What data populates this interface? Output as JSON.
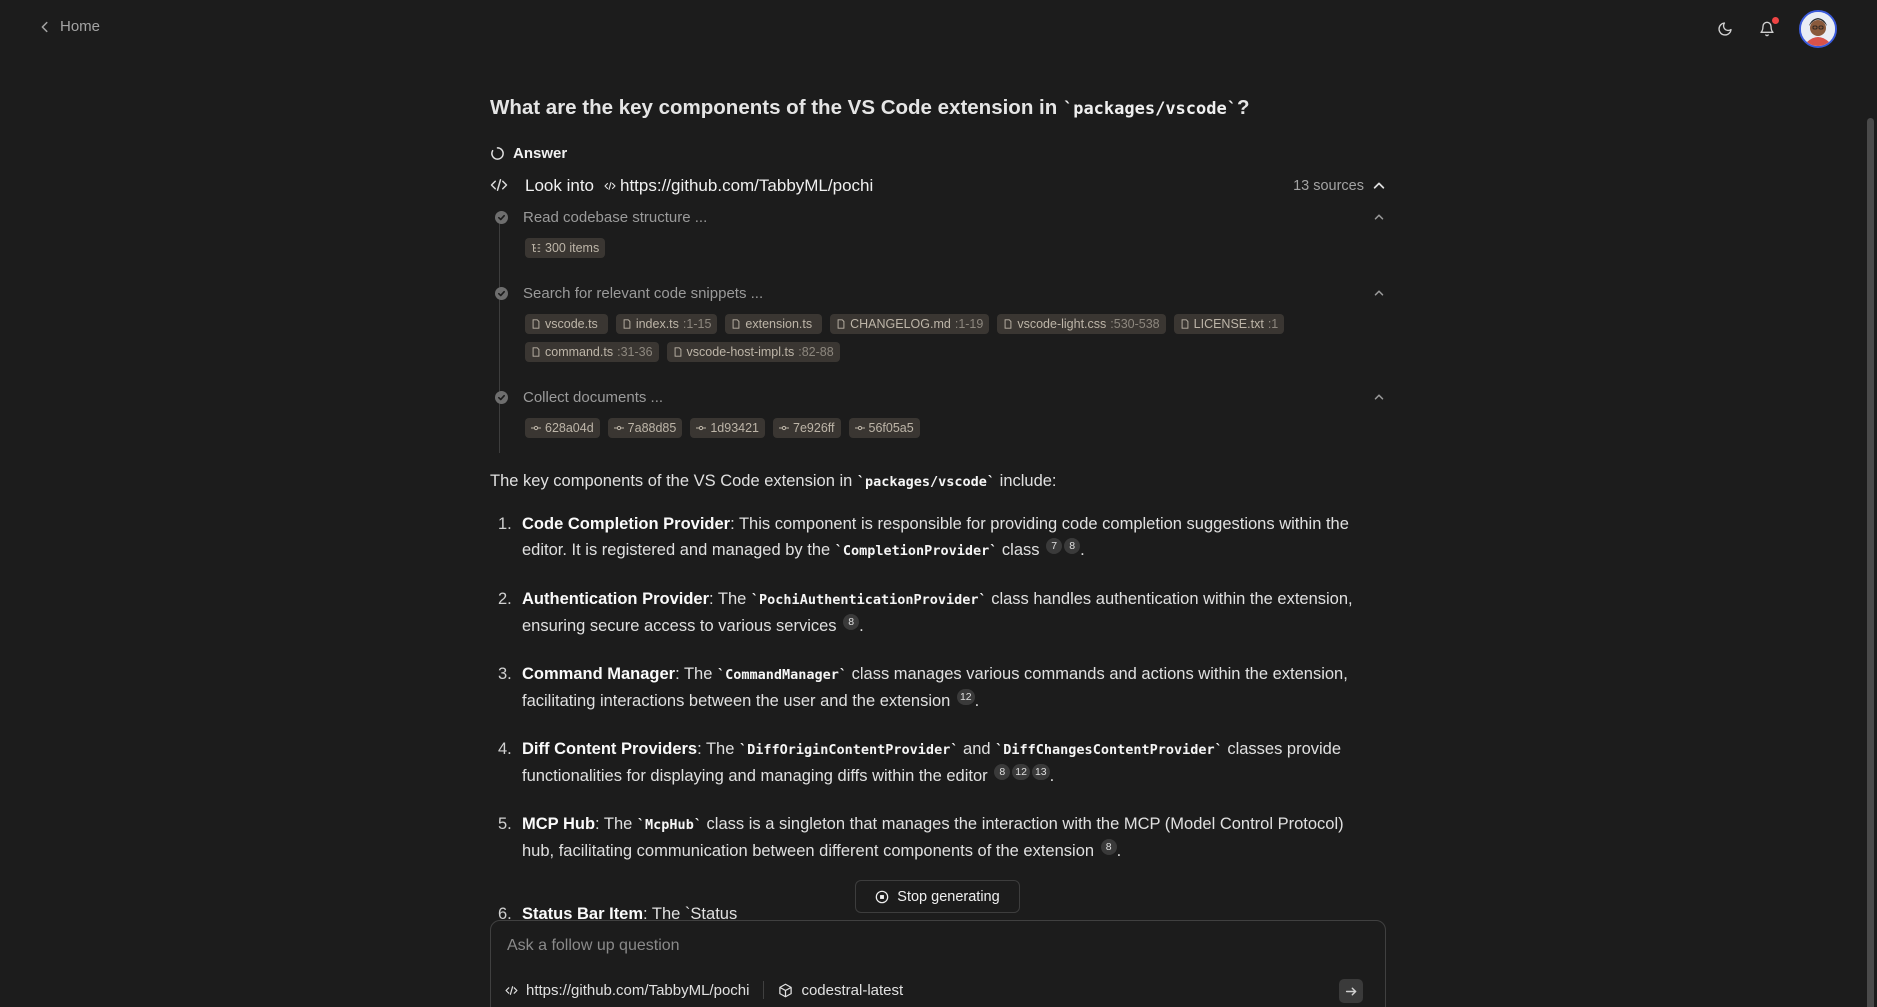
{
  "header": {
    "home_label": "Home",
    "icons": [
      "moon-icon",
      "bell-icon",
      "user-avatar"
    ]
  },
  "question": {
    "prefix": "What are the key components of the VS Code extension in ",
    "code": "`packages/vscode`",
    "suffix": "?"
  },
  "answer": {
    "label": "Answer",
    "look_into_label": "Look into",
    "repo_url": "https://github.com/TabbyML/pochi",
    "sources_label": "13 sources"
  },
  "steps": [
    {
      "title": "Read codebase structure ...",
      "chips": [
        {
          "name": "300 items",
          "range": ""
        }
      ]
    },
    {
      "title": "Search for relevant code snippets ...",
      "chips": [
        {
          "name": "vscode.ts",
          "range": ""
        },
        {
          "name": "index.ts",
          "range": ":1-15"
        },
        {
          "name": "extension.ts",
          "range": ""
        },
        {
          "name": "CHANGELOG.md",
          "range": ":1-19"
        },
        {
          "name": "vscode-light.css",
          "range": ":530-538"
        },
        {
          "name": "LICENSE.txt",
          "range": ":1"
        },
        {
          "name": "command.ts",
          "range": ":31-36"
        },
        {
          "name": "vscode-host-impl.ts",
          "range": ":82-88"
        }
      ]
    },
    {
      "title": "Collect documents ...",
      "chips": [
        {
          "name": "628a04d",
          "range": ""
        },
        {
          "name": "7a88d85",
          "range": ""
        },
        {
          "name": "1d93421",
          "range": ""
        },
        {
          "name": "7e926ff",
          "range": ""
        },
        {
          "name": "56f05a5",
          "range": ""
        }
      ]
    }
  ],
  "intro": {
    "prefix": "The key components of the VS Code extension in ",
    "code": "`packages/vscode`",
    "suffix": " include:"
  },
  "items": [
    {
      "num": "1.",
      "title": "Code Completion Provider",
      "t1": ": This component is responsible for providing code completion suggestions within the editor. It is registered and managed by the ",
      "c1": "`CompletionProvider`",
      "t2": " class",
      "c2": "",
      "t3": "",
      "cites": [
        "7",
        "8"
      ],
      "end": "."
    },
    {
      "num": "2.",
      "title": "Authentication Provider",
      "t1": ": The ",
      "c1": "`PochiAuthenticationProvider`",
      "t2": " class handles authentication within the extension, ensuring secure access to various services",
      "c2": "",
      "t3": "",
      "cites": [
        "8"
      ],
      "end": "."
    },
    {
      "num": "3.",
      "title": "Command Manager",
      "t1": ": The ",
      "c1": "`CommandManager`",
      "t2": " class manages various commands and actions within the extension, facilitating interactions between the user and the extension",
      "c2": "",
      "t3": "",
      "cites": [
        "12"
      ],
      "end": "."
    },
    {
      "num": "4.",
      "title": "Diff Content Providers",
      "t1": ": The ",
      "c1": "`DiffOriginContentProvider`",
      "t2": " and ",
      "c2": "`DiffChangesContentProvider`",
      "t3": " classes provide functionalities for displaying and managing diffs within the editor",
      "cites": [
        "8",
        "12",
        "13"
      ],
      "end": "."
    },
    {
      "num": "5.",
      "title": "MCP Hub",
      "t1": ": The ",
      "c1": "`McpHub`",
      "t2": " class is a singleton that manages the interaction with the MCP (Model Control Protocol) hub, facilitating communication between different components of the extension",
      "c2": "",
      "t3": "",
      "cites": [
        "8"
      ],
      "end": "."
    }
  ],
  "partial_item": {
    "num": "6.",
    "title": "Status Bar Item",
    "text": ": The `Status"
  },
  "stop_label": "Stop generating",
  "followup": {
    "placeholder": "Ask a follow up question",
    "repo": "https://github.com/TabbyML/pochi",
    "model": "codestral-latest"
  }
}
